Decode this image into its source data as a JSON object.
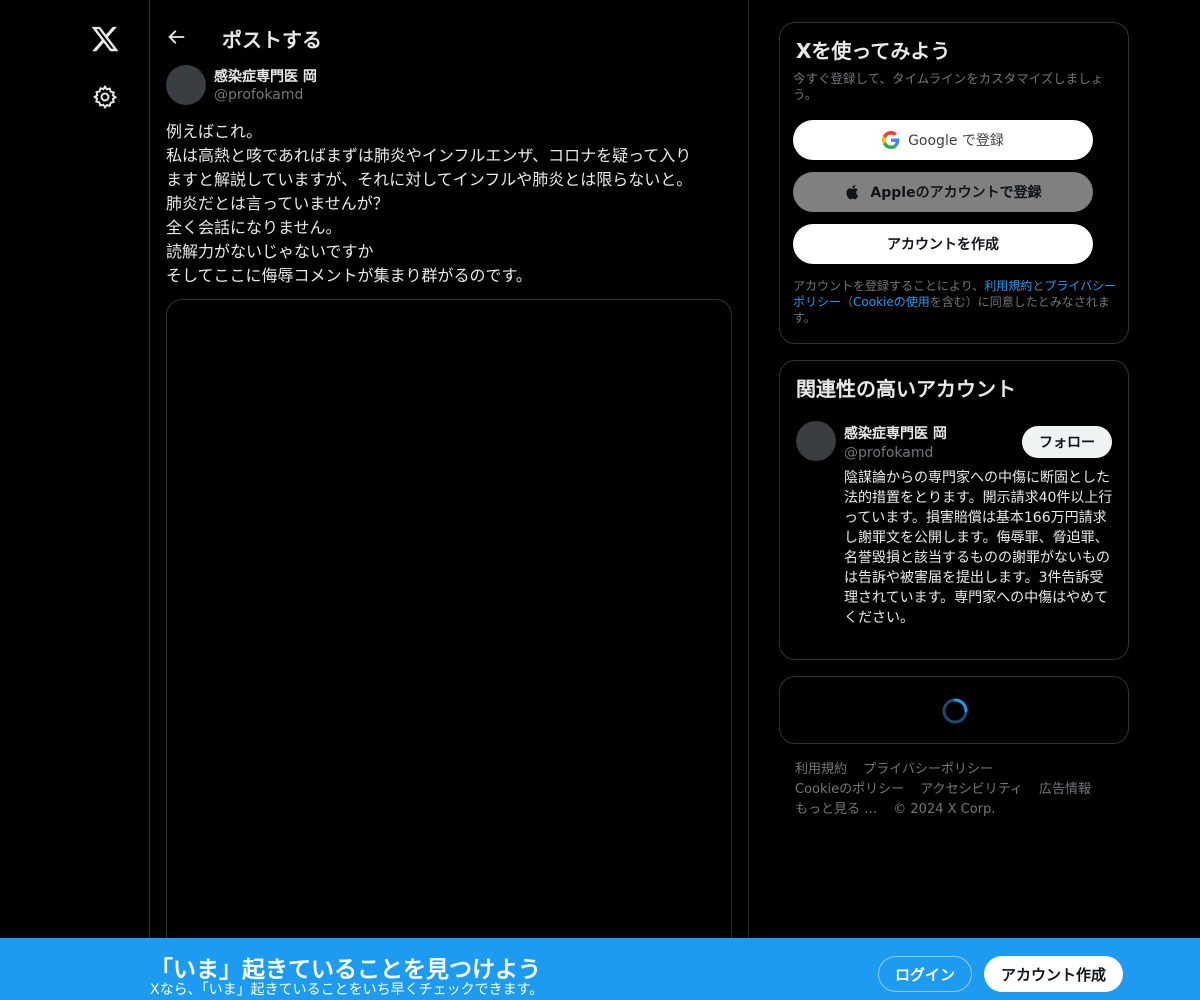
{
  "rail": {
    "logo_icon": "x-logo-icon",
    "settings_icon": "gear-icon"
  },
  "header": {
    "back_icon": "arrow-left-icon",
    "title": "ポストする"
  },
  "post": {
    "author_name": "感染症専門医 岡",
    "author_handle": "@profokamd",
    "lines": [
      "例えばこれ。",
      "私は高熱と咳であればまずは肺炎やインフルエンザ、コロナを疑って入り",
      "ますと解説していますが、それに対してインフルや肺炎とは限らないと。",
      "肺炎だとは言っていませんが？",
      "全く会話になりません。",
      "読解力がないじゃないですか",
      "そしてここに侮辱コメントが集まり群がるのです。"
    ]
  },
  "signup_card": {
    "title": "Xを使ってみよう",
    "subtitle": "今すぐ登録して、タイムラインをカスタマイズしましょう。",
    "google_label": "Google で登録",
    "apple_label": "Appleのアカウントで登録",
    "create_label": "アカウントを作成",
    "legal_prefix": "アカウントを登録することにより、",
    "legal_terms": "利用規約",
    "legal_and": "と",
    "legal_privacy": "プライバシーポリシー",
    "legal_open": "（",
    "legal_cookie": "Cookieの使用",
    "legal_suffix": "を含む）に同意したとみなされます。"
  },
  "related_card": {
    "title": "関連性の高いアカウント",
    "name": "感染症専門医 岡",
    "handle": "@profokamd",
    "follow_label": "フォロー",
    "bio": "陰謀論からの専門家への中傷に断固とした法的措置をとります。開示請求40件以上行っています。損害賠償は基本166万円請求し謝罪文を公開します。侮辱罪、脅迫罪、名誉毀損と該当するものの謝罪がないものは告訴や被害届を提出します。3件告訴受理されています。専門家への中傷はやめてください。"
  },
  "footer": {
    "links": [
      "利用規約",
      "プライバシーポリシー",
      "Cookieのポリシー",
      "アクセシビリティ",
      "広告情報",
      "もっと見る …",
      "© 2024 X Corp."
    ]
  },
  "bottom_bar": {
    "title": "「いま」起きていることを見つけよう",
    "subtitle": "Xなら、「いま」起きていることをいち早くチェックできます。",
    "login_label": "ログイン",
    "signup_label": "アカウント作成"
  },
  "colors": {
    "accent": "#1d9bf0",
    "background": "#000000",
    "border": "#2f3336",
    "muted_text": "#71767b"
  }
}
